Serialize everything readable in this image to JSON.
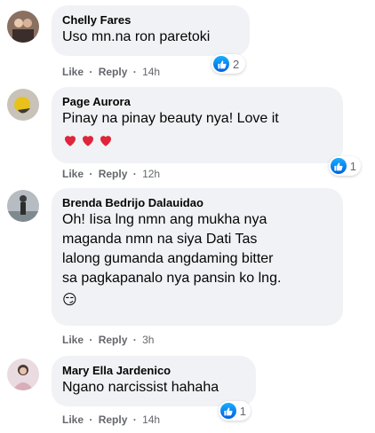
{
  "colors": {
    "bubble": "#f0f2f5",
    "meta": "#65676b",
    "like_blue": "#1877f2",
    "heart_red": "#f02849"
  },
  "comments": [
    {
      "author": "Chelly Fares",
      "text": "Uso mn.na ron paretoki",
      "like": "Like",
      "reply": "Reply",
      "time": "14h",
      "reactions": "2"
    },
    {
      "author": "Page Aurora",
      "text": "Pinay na pinay beauty nya! Love it",
      "emoji": "❤❤❤",
      "like": "Like",
      "reply": "Reply",
      "time": "12h",
      "reactions": "1"
    },
    {
      "author": "Brenda Bedrijo Dalauidao",
      "text": "Oh! Iisa lng nmn ang mukha nya\nmaganda nmn na siya Dati Tas\nlalong gumanda angdaming bitter\nsa pagkapanalo nya pansin ko lng.",
      "emoji": "😏",
      "like": "Like",
      "reply": "Reply",
      "time": "3h"
    },
    {
      "author": "Mary Ella Jardenico",
      "text": "Ngano narcissist hahaha",
      "like": "Like",
      "reply": "Reply",
      "time": "14h",
      "reactions": "1"
    }
  ],
  "sep": "·"
}
